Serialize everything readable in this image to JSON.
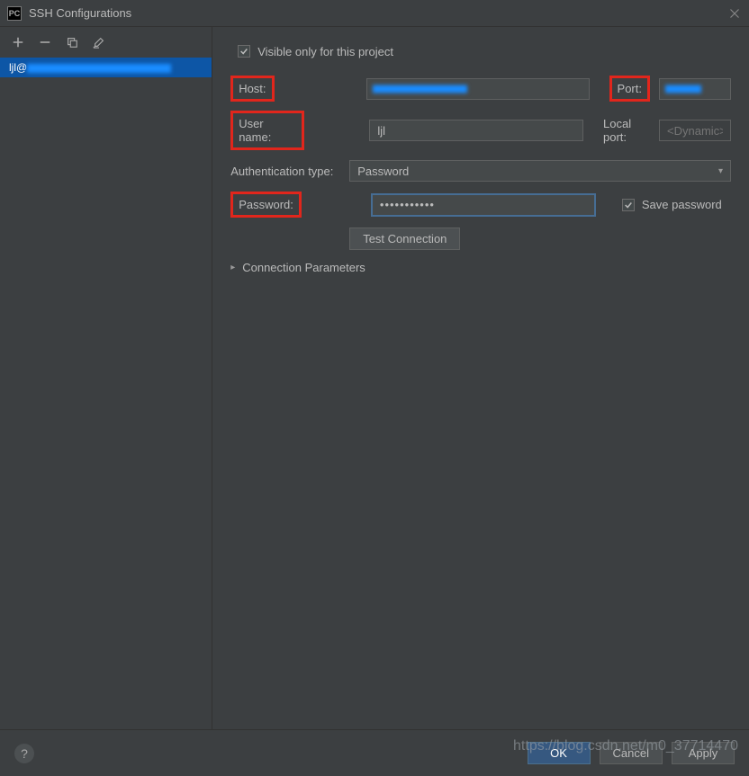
{
  "titlebar": {
    "icon_text": "PC",
    "title": "SSH Configurations"
  },
  "sidebar": {
    "entry_prefix": "ljl@"
  },
  "form": {
    "visible_only_label": "Visible only for this project",
    "host_label": "Host:",
    "port_label": "Port:",
    "user_label": "User name:",
    "user_value": "ljl",
    "localport_label": "Local port:",
    "localport_placeholder": "<Dynamic>",
    "auth_label": "Authentication type:",
    "auth_value": "Password",
    "password_label": "Password:",
    "password_value": "•••••••••••",
    "save_password_label": "Save password",
    "test_button": "Test Connection",
    "connection_params_label": "Connection Parameters"
  },
  "footer": {
    "ok": "OK",
    "cancel": "Cancel",
    "apply": "Apply"
  },
  "watermark": "https://blog.csdn.net/m0_37714470"
}
